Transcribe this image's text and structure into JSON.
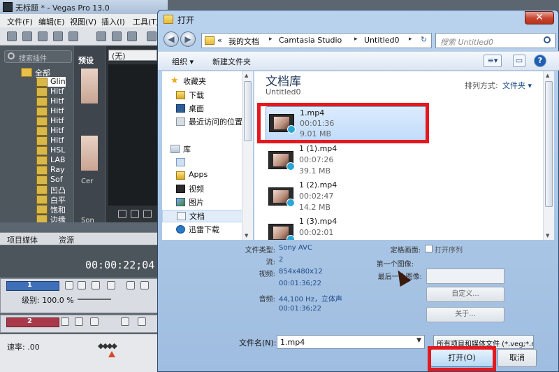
{
  "vegas": {
    "title": "无标题 * - Vegas Pro 13.0",
    "menu": [
      "文件(F)",
      "编辑(E)",
      "视图(V)",
      "插入(I)",
      "工具(T)"
    ],
    "fx_search_placeholder": "搜索插件",
    "tree_root": "全部",
    "tree_items": [
      "Glin",
      "Hitf",
      "Hitf",
      "Hitf",
      "Hitf",
      "Hitf",
      "Hitf",
      "HSL",
      "LAB",
      "Ray",
      "Sof",
      "凹凸",
      "白平",
      "饱和",
      "边缘"
    ],
    "preview_label": "预设",
    "preview_captions": [
      "Cer",
      "Son"
    ],
    "viewer_combo": "(无)",
    "tabs": [
      "项目媒体",
      "资源"
    ],
    "timecode": "00:00:22;04",
    "track1_num": "1",
    "track1_level": "级别: 100.0 %",
    "track2_num": "2",
    "rate_label": "速率: .00",
    "rate_diamonds": "◆◆◆◆"
  },
  "dialog": {
    "title": "打开",
    "close": "✕",
    "nav_back": "◀",
    "nav_forward": "▶",
    "address": {
      "overflow": "«",
      "crumbs": [
        "我的文档",
        "Camtasia Studio",
        "Untitled0"
      ],
      "sep": "▸",
      "refresh": "↻"
    },
    "search_placeholder": "搜索 Untitled0",
    "commands": {
      "organize": "组织 ▾",
      "new_folder": "新建文件夹",
      "view": "≡▾",
      "pane": "▭",
      "help": "?"
    },
    "nav": {
      "favorites": "收藏夹",
      "download": "下载",
      "desktop": "桌面",
      "recent": "最近访问的位置",
      "library": "库",
      "unnamed": "",
      "apps": "Apps",
      "video": "视频",
      "pictures": "图片",
      "documents": "文档",
      "thunder": "迅雷下载"
    },
    "library": {
      "title": "文档库",
      "subtitle": "Untitled0",
      "sort_label": "排列方式:",
      "sort_value": "文件夹 ▾"
    },
    "files": [
      {
        "name": "1.mp4",
        "duration": "00:01:36",
        "size": "9.01 MB"
      },
      {
        "name": "1 (1).mp4",
        "duration": "00:07:26",
        "size": "39.1 MB"
      },
      {
        "name": "1 (2).mp4",
        "duration": "00:02:47",
        "size": "14.2 MB"
      },
      {
        "name": "1 (3).mp4",
        "duration": "00:02:01",
        "size": ""
      }
    ],
    "details": {
      "type_label": "文件类型:",
      "type_value": "Sony AVC",
      "stream_label": "流:",
      "stream_value": "2",
      "video_label": "视频:",
      "video_value": "854x480x12",
      "video_dur": "00:01:36;22",
      "audio_label": "音频:",
      "audio_value": "44,100 Hz，立体声",
      "audio_dur": "00:01:36;22",
      "still_label": "定格画面:",
      "open_seq": "打开序列",
      "first_img": "第一个图像:",
      "last_img": "最后一个图像:",
      "custom_btn": "自定义...",
      "about_btn": "关于..."
    },
    "filename_label": "文件名(N):",
    "filename_value": "1.mp4",
    "filetype_value": "所有项目和媒体文件 (*.veg;*.m",
    "open_btn": "打开(O)",
    "cancel_btn": "取消"
  },
  "colors": {
    "highlight_box": "#e3191f",
    "accent": "#1d4a86"
  }
}
